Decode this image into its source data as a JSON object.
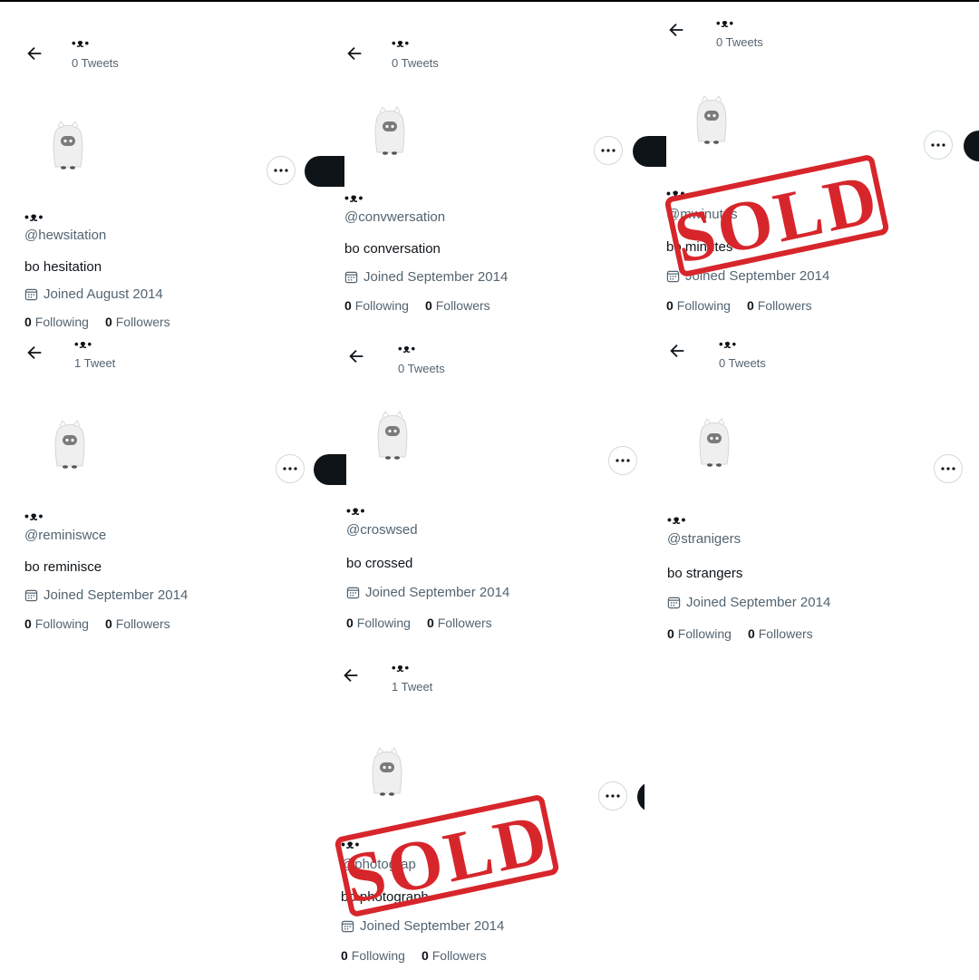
{
  "profiles": [
    {
      "name": "•ᴥ•",
      "tweets": "0 Tweets",
      "handle": "@hewsitation",
      "bio": "bo hesitation",
      "joined": "Joined August 2014",
      "following_count": "0",
      "following_label": "Following",
      "followers_count": "0",
      "followers_label": "Followers",
      "sold": false
    },
    {
      "name": "•ᴥ•",
      "tweets": "0 Tweets",
      "handle": "@convwersation",
      "bio": "bo conversation",
      "joined": "Joined September 2014",
      "following_count": "0",
      "following_label": "Following",
      "followers_count": "0",
      "followers_label": "Followers",
      "sold": false
    },
    {
      "name": "•ᴥ•",
      "tweets": "0 Tweets",
      "handle": "@mwinutes",
      "bio": "bo minutes",
      "joined": "Joined September 2014",
      "following_count": "0",
      "following_label": "Following",
      "followers_count": "0",
      "followers_label": "Followers",
      "sold": true
    },
    {
      "name": "•ᴥ•",
      "tweets": "1 Tweet",
      "handle": "@reminiswce",
      "bio": "bo reminisce",
      "joined": "Joined September 2014",
      "following_count": "0",
      "following_label": "Following",
      "followers_count": "0",
      "followers_label": "Followers",
      "sold": false
    },
    {
      "name": "•ᴥ•",
      "tweets": "0 Tweets",
      "handle": "@croswsed",
      "bio": "bo crossed",
      "joined": "Joined September 2014",
      "following_count": "0",
      "following_label": "Following",
      "followers_count": "0",
      "followers_label": "Followers",
      "sold": false
    },
    {
      "name": "•ᴥ•",
      "tweets": "0 Tweets",
      "handle": "@stranigers",
      "bio": "bo strangers",
      "joined": "Joined September 2014",
      "following_count": "0",
      "following_label": "Following",
      "followers_count": "0",
      "followers_label": "Followers",
      "sold": false
    },
    {
      "name": "•ᴥ•",
      "tweets": "1 Tweet",
      "handle": "@photograp",
      "bio": "bo photograph",
      "joined": "Joined September 2014",
      "following_count": "0",
      "following_label": "Following",
      "followers_count": "0",
      "followers_label": "Followers",
      "sold": true
    }
  ],
  "stamp": {
    "text": "SOLD",
    "color": "#d7262b"
  },
  "icons": {
    "back": "arrow-left-icon",
    "more": "more-dots-icon",
    "calendar": "calendar-icon",
    "avatar": "ghost-avatar-icon"
  }
}
